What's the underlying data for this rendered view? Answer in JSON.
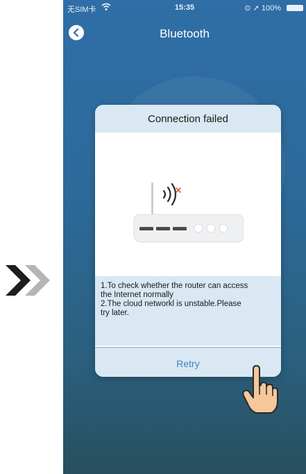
{
  "status_bar": {
    "carrier": "无SIM卡",
    "time": "15:35",
    "battery": "100%"
  },
  "nav": {
    "title": "Bluetooth",
    "back_icon": "chevron-left-icon"
  },
  "dialog": {
    "title": "Connection failed",
    "message": "1.To check whether the router can access\nthe Internet normally\n2.The cloud networkl is unstable.Please\ntry later.",
    "retry_label": "Retry"
  },
  "colors": {
    "accent": "#3d86c6",
    "panel": "#d9e8f2",
    "error": "#e05a3c"
  }
}
